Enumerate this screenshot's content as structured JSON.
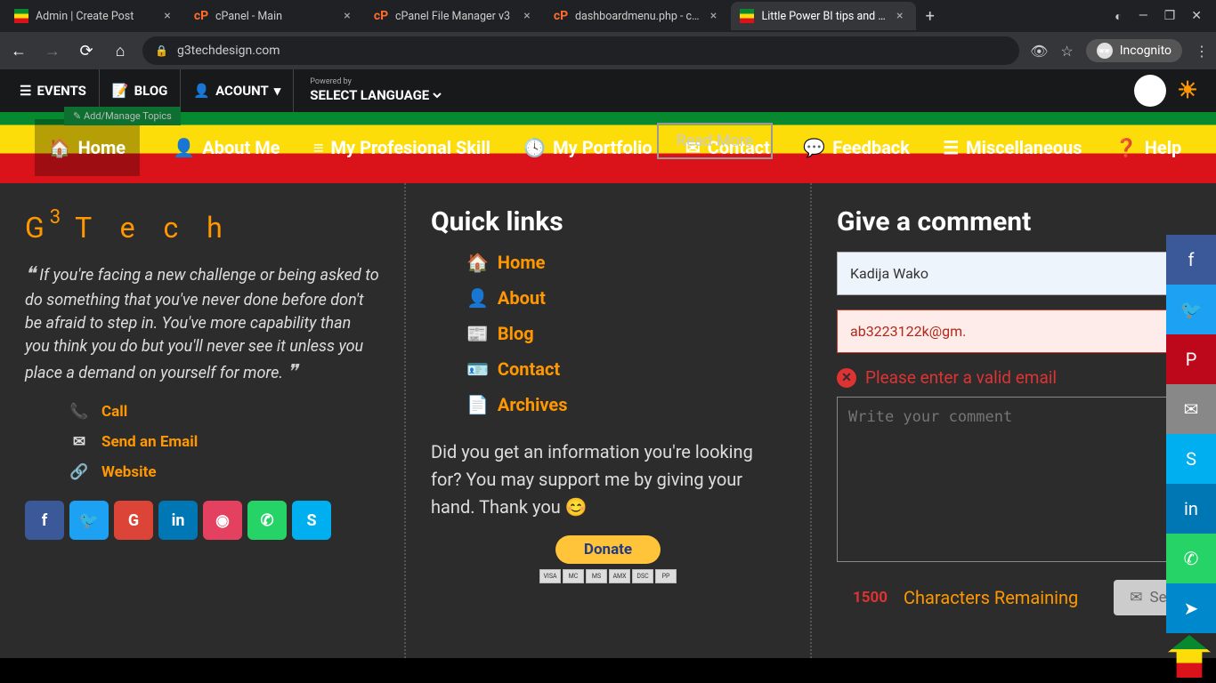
{
  "browser": {
    "tabs": [
      {
        "label": "Admin | Create Post",
        "favicon": "eth"
      },
      {
        "label": "cPanel - Main",
        "favicon": "cp"
      },
      {
        "label": "cPanel File Manager v3",
        "favicon": "cp"
      },
      {
        "label": "dashboardmenu.php - c…",
        "favicon": "cp"
      },
      {
        "label": "Little Power BI tips and …",
        "favicon": "eth",
        "active": true
      }
    ],
    "url": "g3techdesign.com",
    "incognito_label": "Incognito"
  },
  "sitebar": {
    "events": "EVENTS",
    "blog": "BLOG",
    "account": "ACOUNT",
    "powered_by": "Powered by",
    "language": "SELECT LANGUAGE"
  },
  "nav": {
    "home": "Home",
    "about": "About Me",
    "skill": "My Profesional Skill",
    "portfolio": "My Portfolio",
    "contact": "Contact",
    "feedback": "Feedback",
    "misc": "Miscellaneous",
    "help": "Help",
    "read_more": "Read More",
    "manage_topics": "✎ Add/Manage Topics"
  },
  "brand": {
    "g": "G",
    "sup": "3",
    "tech": "T e c h"
  },
  "quote": "If  you're facing a new challenge or being asked to do something that you've never done before don't be afraid to step in. You've more capability than you think you do but you'll never see it unless you place a demand on yourself for more.",
  "contacts": {
    "call": "Call",
    "email": "Send an Email",
    "website": "Website"
  },
  "quicklinks": {
    "heading": "Quick links",
    "items": {
      "home": "Home",
      "about": "About",
      "blog": "Blog",
      "contact": "Contact",
      "archives": "Archives"
    },
    "support": "Did you get an information you're looking for? You may support me by giving your hand. Thank you 😊",
    "donate": "Donate"
  },
  "comment": {
    "heading": "Give a comment",
    "name_value": "Kadija Wako",
    "email_value": "ab3223122k@gm.",
    "error": "Please enter a valid email",
    "textarea_placeholder": "Write your comment",
    "count": "1500",
    "remaining": "Characters Remaining",
    "send": "Sen"
  }
}
